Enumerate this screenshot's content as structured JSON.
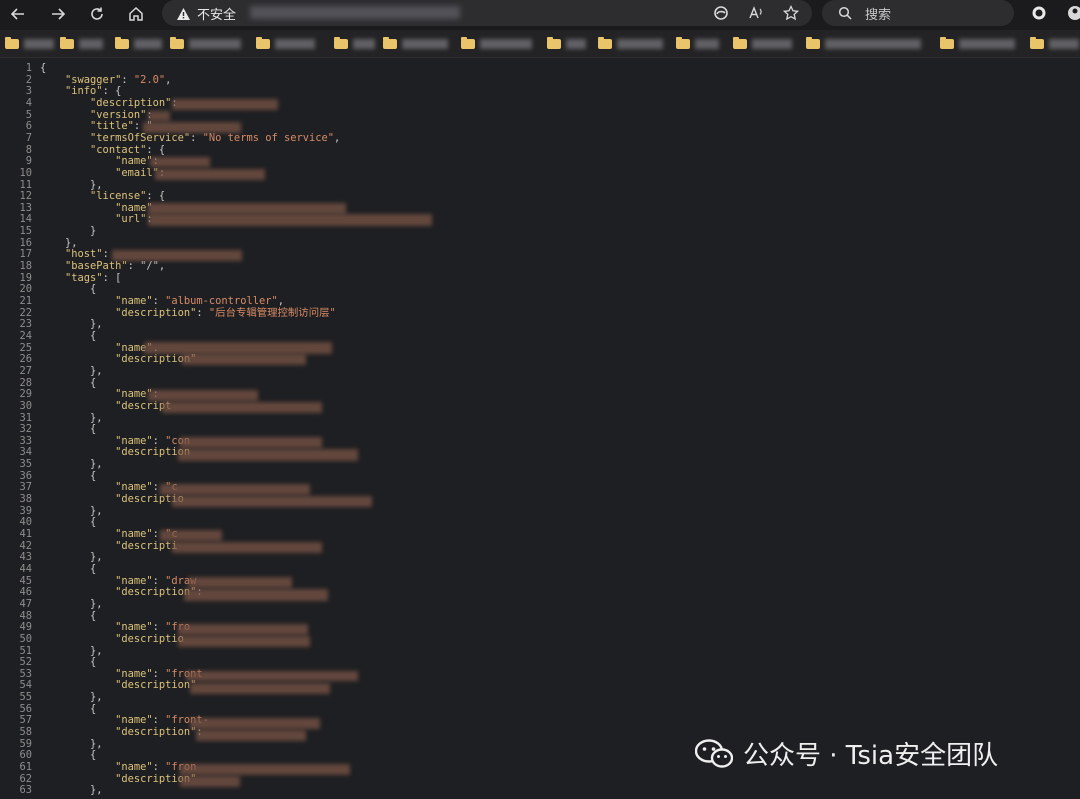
{
  "toolbar": {
    "insecure_label": "不安全",
    "search_placeholder": "搜索"
  },
  "watermark": {
    "text": "公众号 · Tsia安全团队"
  },
  "code_lines": [
    [
      {
        "t": "p",
        "v": "{"
      }
    ],
    [
      {
        "t": "k",
        "v": "    \"swagger\""
      },
      {
        "t": "p",
        "v": ": "
      },
      {
        "t": "s",
        "v": "\"2.0\""
      },
      {
        "t": "p",
        "v": ","
      }
    ],
    [
      {
        "t": "k",
        "v": "    \"info\""
      },
      {
        "t": "p",
        "v": ": {"
      }
    ],
    [
      {
        "t": "k",
        "v": "        \"description\""
      },
      {
        "t": "p",
        "v": ":"
      }
    ],
    [
      {
        "t": "k",
        "v": "        \"version\""
      },
      {
        "t": "p",
        "v": ": "
      }
    ],
    [
      {
        "t": "k",
        "v": "        \"title\""
      },
      {
        "t": "p",
        "v": ": \""
      }
    ],
    [
      {
        "t": "k",
        "v": "        \"termsOfService\""
      },
      {
        "t": "p",
        "v": ": "
      },
      {
        "t": "s",
        "v": "\"No terms of service\""
      },
      {
        "t": "p",
        "v": ","
      }
    ],
    [
      {
        "t": "k",
        "v": "        \"contact\""
      },
      {
        "t": "p",
        "v": ": {"
      }
    ],
    [
      {
        "t": "k",
        "v": "            \"name\""
      },
      {
        "t": "p",
        "v": ": "
      }
    ],
    [
      {
        "t": "k",
        "v": "            \"email\""
      },
      {
        "t": "p",
        "v": ":"
      }
    ],
    [
      {
        "t": "p",
        "v": "        },"
      }
    ],
    [
      {
        "t": "k",
        "v": "        \"license\""
      },
      {
        "t": "p",
        "v": ": {"
      }
    ],
    [
      {
        "t": "k",
        "v": "            \"name\""
      },
      {
        "t": "p",
        "v": ""
      }
    ],
    [
      {
        "t": "k",
        "v": "            \"url\""
      },
      {
        "t": "p",
        "v": ":"
      }
    ],
    [
      {
        "t": "p",
        "v": "        }"
      }
    ],
    [
      {
        "t": "p",
        "v": "    },"
      }
    ],
    [
      {
        "t": "k",
        "v": "    \"host\""
      },
      {
        "t": "p",
        "v": ": "
      }
    ],
    [
      {
        "t": "k",
        "v": "    \"basePath\""
      },
      {
        "t": "p",
        "v": ": \"/\","
      }
    ],
    [
      {
        "t": "k",
        "v": "    \"tags\""
      },
      {
        "t": "p",
        "v": ": ["
      }
    ],
    [
      {
        "t": "p",
        "v": "        {"
      }
    ],
    [
      {
        "t": "k",
        "v": "            \"name\""
      },
      {
        "t": "p",
        "v": ": "
      },
      {
        "t": "s",
        "v": "\"album-controller\""
      },
      {
        "t": "p",
        "v": ","
      }
    ],
    [
      {
        "t": "k",
        "v": "            \"description\""
      },
      {
        "t": "p",
        "v": ": "
      },
      {
        "t": "s",
        "v": "\"后台专辑管理控制访问层\""
      }
    ],
    [
      {
        "t": "p",
        "v": "        },"
      }
    ],
    [
      {
        "t": "p",
        "v": "        {"
      }
    ],
    [
      {
        "t": "k",
        "v": "            \"name\""
      },
      {
        "t": "p",
        "v": "."
      }
    ],
    [
      {
        "t": "k",
        "v": "            \"description\""
      },
      {
        "t": "p",
        "v": ""
      }
    ],
    [
      {
        "t": "p",
        "v": "        },"
      }
    ],
    [
      {
        "t": "p",
        "v": "        {"
      }
    ],
    [
      {
        "t": "k",
        "v": "            \"name\""
      },
      {
        "t": "p",
        "v": ":"
      }
    ],
    [
      {
        "t": "k",
        "v": "            \"descript"
      }
    ],
    [
      {
        "t": "p",
        "v": "        },"
      }
    ],
    [
      {
        "t": "p",
        "v": "        {"
      }
    ],
    [
      {
        "t": "k",
        "v": "            \"name\""
      },
      {
        "t": "p",
        "v": ": "
      },
      {
        "t": "s",
        "v": "\"con"
      }
    ],
    [
      {
        "t": "k",
        "v": "            \"description"
      }
    ],
    [
      {
        "t": "p",
        "v": "        },"
      }
    ],
    [
      {
        "t": "p",
        "v": "        {"
      }
    ],
    [
      {
        "t": "k",
        "v": "            \"name\""
      },
      {
        "t": "p",
        "v": ": "
      },
      {
        "t": "s",
        "v": "\"c"
      }
    ],
    [
      {
        "t": "k",
        "v": "            \"descriptio"
      }
    ],
    [
      {
        "t": "p",
        "v": "        },"
      }
    ],
    [
      {
        "t": "p",
        "v": "        {"
      }
    ],
    [
      {
        "t": "k",
        "v": "            \"name\""
      },
      {
        "t": "p",
        "v": ": "
      },
      {
        "t": "s",
        "v": "\"c"
      }
    ],
    [
      {
        "t": "k",
        "v": "            \"descripti"
      }
    ],
    [
      {
        "t": "p",
        "v": "        },"
      }
    ],
    [
      {
        "t": "p",
        "v": "        {"
      }
    ],
    [
      {
        "t": "k",
        "v": "            \"name\""
      },
      {
        "t": "p",
        "v": ": "
      },
      {
        "t": "s",
        "v": "\"draw"
      }
    ],
    [
      {
        "t": "k",
        "v": "            \"description\""
      },
      {
        "t": "p",
        "v": ":"
      }
    ],
    [
      {
        "t": "p",
        "v": "        },"
      }
    ],
    [
      {
        "t": "p",
        "v": "        {"
      }
    ],
    [
      {
        "t": "k",
        "v": "            \"name\""
      },
      {
        "t": "p",
        "v": ": "
      },
      {
        "t": "s",
        "v": "\"fro"
      }
    ],
    [
      {
        "t": "k",
        "v": "            \"descriptio"
      }
    ],
    [
      {
        "t": "p",
        "v": "        },"
      }
    ],
    [
      {
        "t": "p",
        "v": "        {"
      }
    ],
    [
      {
        "t": "k",
        "v": "            \"name\""
      },
      {
        "t": "p",
        "v": ": "
      },
      {
        "t": "s",
        "v": "\"front"
      }
    ],
    [
      {
        "t": "k",
        "v": "            \"description\""
      }
    ],
    [
      {
        "t": "p",
        "v": "        },"
      }
    ],
    [
      {
        "t": "p",
        "v": "        {"
      }
    ],
    [
      {
        "t": "k",
        "v": "            \"name\""
      },
      {
        "t": "p",
        "v": ": "
      },
      {
        "t": "s",
        "v": "\"front-"
      }
    ],
    [
      {
        "t": "k",
        "v": "            \"description\""
      },
      {
        "t": "p",
        "v": ":"
      }
    ],
    [
      {
        "t": "p",
        "v": "        },"
      }
    ],
    [
      {
        "t": "p",
        "v": "        {"
      }
    ],
    [
      {
        "t": "k",
        "v": "            \"name\""
      },
      {
        "t": "p",
        "v": ": "
      },
      {
        "t": "s",
        "v": "\"fron"
      }
    ],
    [
      {
        "t": "k",
        "v": "            \"description\""
      }
    ],
    [
      {
        "t": "p",
        "v": "        },"
      }
    ]
  ]
}
